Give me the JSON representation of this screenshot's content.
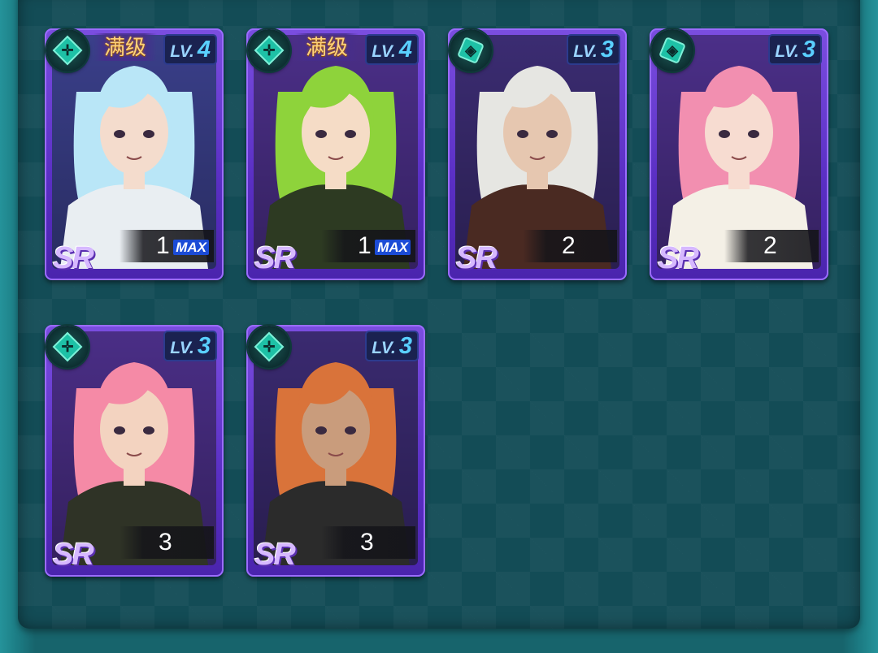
{
  "colors": {
    "panel": "#134c56",
    "card": "#6a3fd6",
    "level": "#5ad0ff",
    "maxlevel": "#ffd37a"
  },
  "cards": [
    {
      "class_icon": "crosshair-icon",
      "max_level_label": "满级",
      "level_label": "LV.",
      "level": "4",
      "count": "1",
      "max_badge": "MAX",
      "rarity": "SR",
      "hair": "#b9e6f7",
      "skin": "#f4dccd",
      "outfit": "#e9eef2",
      "bg": "#3a3f8a"
    },
    {
      "class_icon": "crosshair-icon",
      "max_level_label": "满级",
      "level_label": "LV.",
      "level": "4",
      "count": "1",
      "max_badge": "MAX",
      "rarity": "SR",
      "hair": "#8ed33b",
      "skin": "#f5dcc6",
      "outfit": "#2d3a22",
      "bg": "#4b2f88"
    },
    {
      "class_icon": "shield-icon",
      "max_level_label": "",
      "level_label": "LV.",
      "level": "3",
      "count": "2",
      "max_badge": "",
      "rarity": "SR",
      "hair": "#e6e6e2",
      "skin": "#e6c7b0",
      "outfit": "#4a2a22",
      "bg": "#3b2c72"
    },
    {
      "class_icon": "shield-icon",
      "max_level_label": "",
      "level_label": "LV.",
      "level": "3",
      "count": "2",
      "max_badge": "",
      "rarity": "SR",
      "hair": "#f28fb0",
      "skin": "#f7dcd1",
      "outfit": "#f4f0e6",
      "bg": "#4b2f88"
    },
    {
      "class_icon": "crosshair-icon",
      "max_level_label": "",
      "level_label": "LV.",
      "level": "3",
      "count": "3",
      "max_badge": "",
      "rarity": "SR",
      "hair": "#f58aa6",
      "skin": "#f3d3c0",
      "outfit": "#2f3326",
      "bg": "#4a2e86"
    },
    {
      "class_icon": "crosshair-icon",
      "max_level_label": "",
      "level_label": "LV.",
      "level": "3",
      "count": "3",
      "max_badge": "",
      "rarity": "SR",
      "hair": "#d9733a",
      "skin": "#c99c7c",
      "outfit": "#2b2b2b",
      "bg": "#3a2a70"
    }
  ]
}
